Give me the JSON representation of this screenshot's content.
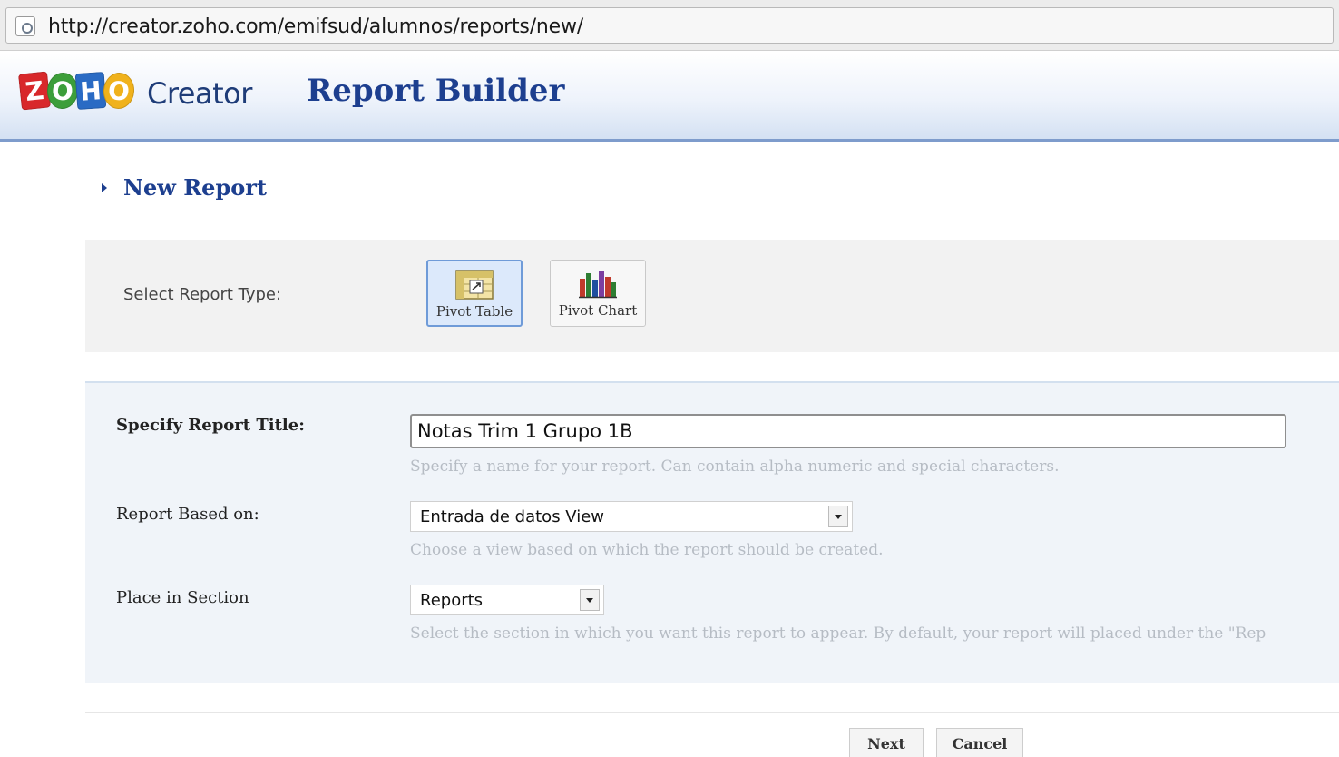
{
  "browser": {
    "url": "http://creator.zoho.com/emifsud/alumnos/reports/new/"
  },
  "header": {
    "logo_letters": [
      "Z",
      "O",
      "H",
      "O"
    ],
    "product_name": "Creator",
    "page_title": "Report Builder"
  },
  "section": {
    "title": "New Report"
  },
  "report_type": {
    "label": "Select Report Type:",
    "options": [
      {
        "label": "Pivot Table",
        "icon": "pivot-table-icon",
        "selected": true
      },
      {
        "label": "Pivot Chart",
        "icon": "pivot-chart-icon",
        "selected": false
      }
    ]
  },
  "form": {
    "title": {
      "label": "Specify Report Title:",
      "value": "Notas Trim 1 Grupo 1B",
      "hint": "Specify a name for your report. Can contain alpha numeric and special characters."
    },
    "based_on": {
      "label": "Report Based on:",
      "value": "Entrada de datos View",
      "hint": "Choose a view based on which the report should be created."
    },
    "section": {
      "label": "Place in Section",
      "value": "Reports",
      "hint": "Select the section in which you want this report to appear. By default, your report will placed under the \"Rep"
    }
  },
  "actions": {
    "next": "Next",
    "cancel": "Cancel"
  },
  "colors": {
    "brand_blue": "#1d3f8f",
    "header_border": "#7e9ccc",
    "selected_bg": "#dce9fb"
  }
}
